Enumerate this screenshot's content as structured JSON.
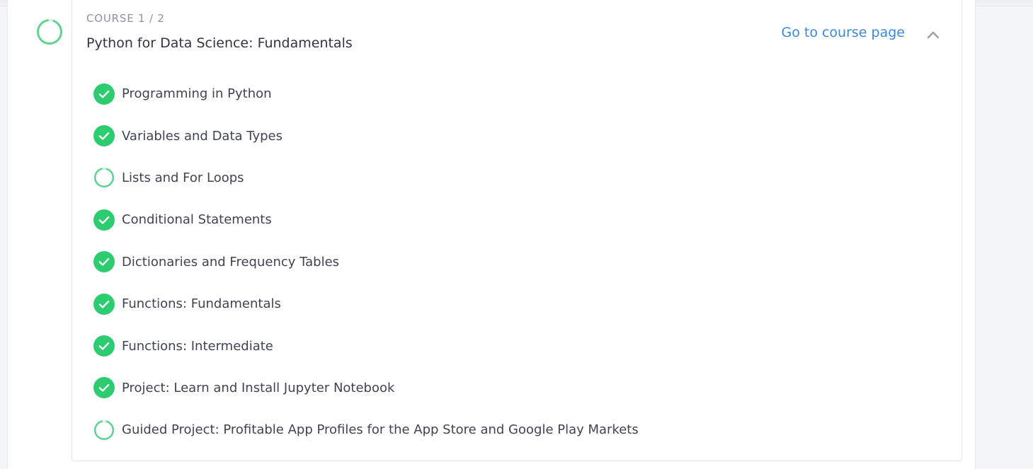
{
  "colors": {
    "success": "#2ecc71",
    "link": "#3e87d8",
    "title": "#2f3541",
    "label": "#8d939d",
    "progress": "#5fd38f"
  },
  "course": {
    "label": "COURSE 1 / 2",
    "title": "Python for Data Science: Fundamentals",
    "link_text": "Go to course page",
    "progress_icon": "progress-ring-icon",
    "collapse_icon": "chevron-up-icon"
  },
  "lessons": [
    {
      "title": "Programming in Python",
      "status": "complete",
      "icon": "check-circle-icon"
    },
    {
      "title": "Variables and Data Types",
      "status": "complete",
      "icon": "check-circle-icon"
    },
    {
      "title": "Lists and For Loops",
      "status": "in-progress",
      "icon": "progress-ring-icon"
    },
    {
      "title": "Conditional Statements",
      "status": "complete",
      "icon": "check-circle-icon"
    },
    {
      "title": "Dictionaries and Frequency Tables",
      "status": "complete",
      "icon": "check-circle-icon"
    },
    {
      "title": "Functions: Fundamentals",
      "status": "complete",
      "icon": "check-circle-icon"
    },
    {
      "title": "Functions: Intermediate",
      "status": "complete",
      "icon": "check-circle-icon"
    },
    {
      "title": "Project: Learn and Install Jupyter Notebook",
      "status": "complete",
      "icon": "check-circle-icon"
    },
    {
      "title": "Guided Project: Profitable App Profiles for the App Store and Google Play Markets",
      "status": "in-progress",
      "icon": "progress-ring-icon"
    }
  ]
}
